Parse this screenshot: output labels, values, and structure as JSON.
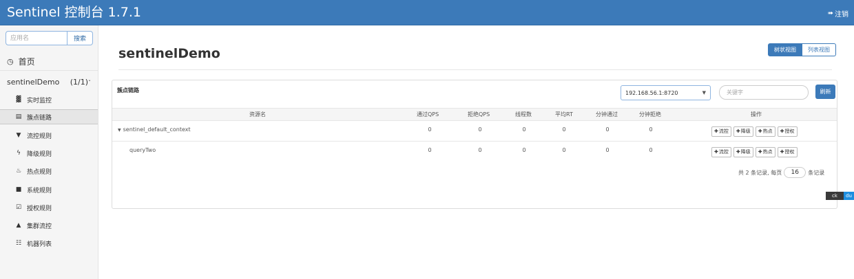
{
  "header": {
    "title": "Sentinel 控制台 1.7.1",
    "logout_label": "注销"
  },
  "sidebar": {
    "search_placeholder": "应用名",
    "search_button": "搜索",
    "home_label": "首页",
    "app": {
      "name": "sentinelDemo",
      "count": "(1/1)"
    },
    "items": [
      {
        "label": "实时监控",
        "icon": "chart-icon"
      },
      {
        "label": "簇点链路",
        "icon": "list-icon"
      },
      {
        "label": "流控规则",
        "icon": "filter-icon"
      },
      {
        "label": "降级规则",
        "icon": "bolt-icon"
      },
      {
        "label": "热点规则",
        "icon": "fire-icon"
      },
      {
        "label": "系统规则",
        "icon": "lock-icon"
      },
      {
        "label": "授权规则",
        "icon": "check-square-icon"
      },
      {
        "label": "集群流控",
        "icon": "cloud-icon"
      },
      {
        "label": "机器列表",
        "icon": "grid-icon"
      }
    ]
  },
  "main": {
    "title": "sentinelDemo",
    "view_tree": "树状视图",
    "view_list": "列表视图",
    "panel_title": "簇点链路",
    "machine": "192.168.56.1:8720",
    "keyword_placeholder": "关键字",
    "refresh": "刷新",
    "columns": [
      "资源名",
      "通过QPS",
      "拒绝QPS",
      "线程数",
      "平均RT",
      "分钟通过",
      "分钟拒绝",
      "操作"
    ],
    "rows": [
      {
        "name": "sentinel_default_context",
        "pass_qps": "0",
        "block_qps": "0",
        "threads": "0",
        "avg_rt": "0",
        "min_pass": "0",
        "min_block": "0"
      },
      {
        "name": "queryTwo",
        "pass_qps": "0",
        "block_qps": "0",
        "threads": "0",
        "avg_rt": "0",
        "min_pass": "0",
        "min_block": "0"
      }
    ],
    "ops": [
      "流控",
      "降级",
      "热点",
      "授权"
    ],
    "pager": {
      "prefix": "共 2 条记录, 每页",
      "page_size": "16",
      "suffix": "条记录"
    }
  },
  "badge": {
    "a": "ck",
    "b": "du"
  },
  "colors": {
    "primary": "#3c7ab9"
  }
}
